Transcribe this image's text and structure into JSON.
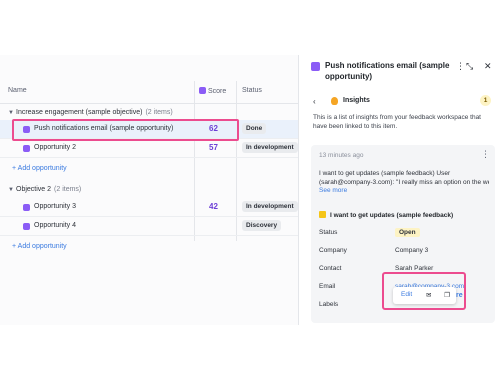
{
  "table": {
    "col_name": "Name",
    "col_score": "Score",
    "col_status": "Status",
    "groups": [
      {
        "title": "Increase engagement (sample objective)",
        "count": "(2 items)",
        "rows": [
          {
            "name": "Push notifications email (sample opportunity)",
            "score": "62",
            "status": "Done"
          },
          {
            "name": "Opportunity 2",
            "score": "57",
            "status": "In development"
          }
        ],
        "add": "+ Add opportunity"
      },
      {
        "title": "Objective 2",
        "count": "(2 items)",
        "rows": [
          {
            "name": "Opportunity 3",
            "score": "42",
            "status": "In development"
          },
          {
            "name": "Opportunity 4",
            "score": "",
            "status": "Discovery"
          }
        ],
        "add": "+ Add opportunity"
      }
    ]
  },
  "panel": {
    "title": "Push notifications email (sample opportunity)",
    "header_icons": [
      "more-vertical-icon",
      "collapse-icon",
      "expand-icon",
      "close-icon"
    ],
    "back": "‹",
    "section": "Insights",
    "section_count": "1",
    "description": "This is a list of insights from your feedback workspace that have been linked to this item.",
    "card": {
      "time": "13 minutes ago",
      "text_line1": "I want to get updates (sample feedback) User",
      "text_line2": "(sarah@company-3.com): \"I really miss an option on the we",
      "see_more": "See more",
      "feedback_title": "I want to get updates (sample feedback)",
      "fields": {
        "status_label": "Status",
        "status_value": "Open",
        "company_label": "Company",
        "company_value": "Company 3",
        "contact_label": "Contact",
        "contact_value": "Sarah Parker",
        "email_label": "Email",
        "email_value": "sarah@company-3.com",
        "labels_label": "Labels"
      },
      "tooltip": {
        "edit": "Edit",
        "trailing": "re"
      }
    }
  },
  "colors": {
    "accent_purple": "#8b5cf6",
    "highlight_pink": "#ec4c8f",
    "link_blue": "#3b7be0"
  }
}
